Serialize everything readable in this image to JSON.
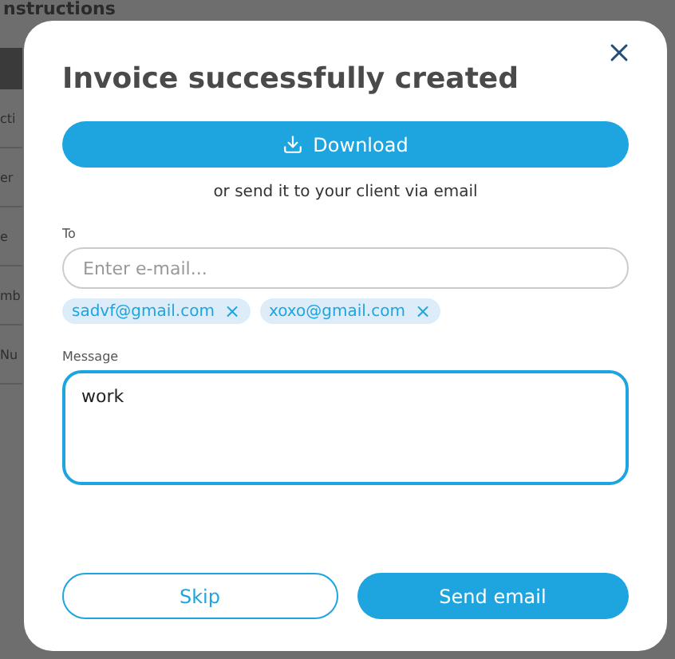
{
  "background": {
    "heading": "nstructions",
    "fragments": [
      "cti",
      "er",
      "e",
      "mb",
      "Nu"
    ]
  },
  "dialog": {
    "title": "Invoice successfully created",
    "download_button": "Download",
    "hint": "or send it to your client via email",
    "to": {
      "label": "To",
      "placeholder": "Enter e-mail...",
      "chips": [
        {
          "text": "sadvf@gmail.com",
          "remove": "×"
        },
        {
          "text": "xoxo@gmail.com",
          "remove": "×"
        }
      ]
    },
    "message": {
      "label": "Message",
      "value": "work",
      "focused": true
    },
    "buttons": [
      {
        "label": "Skip",
        "kind": "secondary"
      },
      {
        "label": "Send email",
        "kind": "primary"
      }
    ]
  }
}
